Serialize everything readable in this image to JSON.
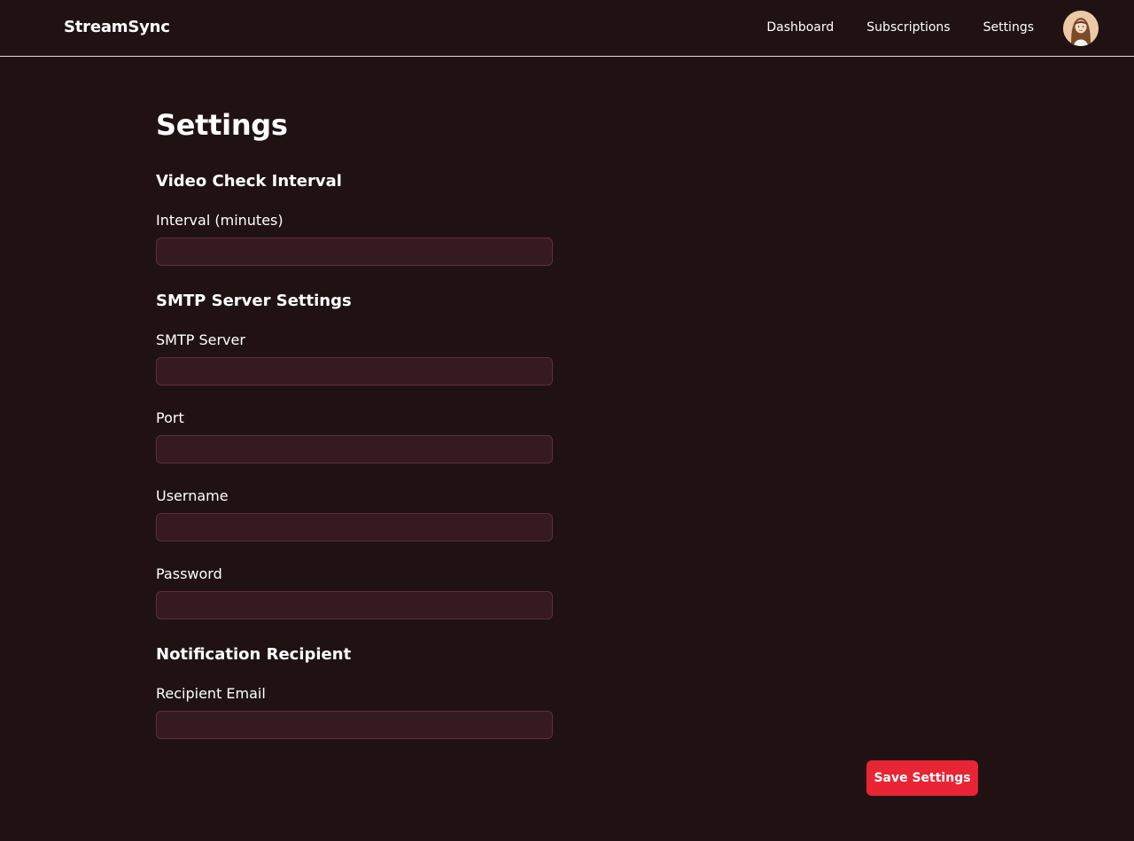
{
  "app": {
    "brand": "StreamSync"
  },
  "nav": {
    "items": [
      {
        "label": "Dashboard"
      },
      {
        "label": "Subscriptions"
      },
      {
        "label": "Settings"
      }
    ]
  },
  "page": {
    "title": "Settings"
  },
  "sections": {
    "interval": {
      "title": "Video Check Interval",
      "fields": {
        "interval": {
          "label": "Interval (minutes)",
          "value": "",
          "placeholder": ""
        }
      }
    },
    "smtp": {
      "title": "SMTP Server Settings",
      "fields": {
        "server": {
          "label": "SMTP Server",
          "value": "",
          "placeholder": ""
        },
        "port": {
          "label": "Port",
          "value": "",
          "placeholder": ""
        },
        "username": {
          "label": "Username",
          "value": "",
          "placeholder": ""
        },
        "password": {
          "label": "Password",
          "value": "",
          "placeholder": ""
        }
      }
    },
    "notification": {
      "title": "Notification Recipient",
      "fields": {
        "email": {
          "label": "Recipient Email",
          "value": "",
          "placeholder": ""
        }
      }
    }
  },
  "actions": {
    "save_label": "Save Settings"
  },
  "colors": {
    "background": "#201213",
    "input_bg": "#351a1f",
    "input_border": "#5e2e39",
    "accent": "#e92434"
  },
  "icons": {
    "avatar": "user-avatar-icon"
  }
}
